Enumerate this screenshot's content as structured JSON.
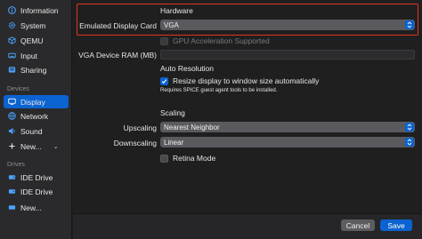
{
  "sidebar": {
    "items_top": [
      {
        "label": "Information",
        "icon": "info-icon"
      },
      {
        "label": "System",
        "icon": "gear-icon"
      },
      {
        "label": "QEMU",
        "icon": "cube-icon"
      },
      {
        "label": "Input",
        "icon": "keyboard-icon"
      },
      {
        "label": "Sharing",
        "icon": "sharing-icon"
      }
    ],
    "devices_header": "Devices",
    "devices": [
      {
        "label": "Display",
        "icon": "display-icon",
        "selected": true
      },
      {
        "label": "Network",
        "icon": "network-icon"
      },
      {
        "label": "Sound",
        "icon": "speaker-icon"
      }
    ],
    "new_device": "New...",
    "drives_header": "Drives",
    "drives": [
      {
        "label": "IDE Drive",
        "icon": "drive-icon"
      },
      {
        "label": "IDE Drive",
        "icon": "drive-icon"
      }
    ],
    "new_drive": "New..."
  },
  "main": {
    "hardware_heading": "Hardware",
    "emulated_display_card_label": "Emulated Display Card",
    "emulated_display_card_value": "VGA",
    "gpu_acceleration_label": "GPU Acceleration Supported",
    "vga_ram_label": "VGA Device RAM (MB)",
    "vga_ram_value": "",
    "auto_resolution_heading": "Auto Resolution",
    "resize_label": "Resize display to window size automatically",
    "resize_checked": true,
    "resize_note": "Requires SPICE guest agent tools to be installed.",
    "scaling_heading": "Scaling",
    "upscaling_label": "Upscaling",
    "upscaling_value": "Nearest Neighbor",
    "downscaling_label": "Downscaling",
    "downscaling_value": "Linear",
    "retina_label": "Retina Mode",
    "retina_checked": false
  },
  "footer": {
    "cancel_label": "Cancel",
    "save_label": "Save"
  },
  "colors": {
    "accent": "#0a63d0",
    "highlight_box": "#e0341f"
  }
}
